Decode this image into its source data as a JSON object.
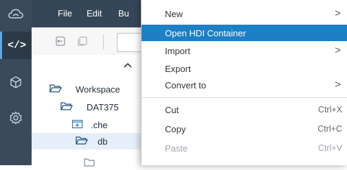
{
  "menubar": {
    "items": [
      "File",
      "Edit",
      "Bu"
    ]
  },
  "rail": {
    "code_label": "</>"
  },
  "tree": {
    "rows": [
      {
        "label": "Workspace",
        "icon": "folder-open-icon"
      },
      {
        "label": "DAT375",
        "icon": "folder-open-icon"
      },
      {
        "label": ".che",
        "icon": "folder-plus-icon"
      },
      {
        "label": "db",
        "icon": "folder-open-icon",
        "selected": true
      }
    ]
  },
  "context_menu": {
    "items": [
      {
        "label": "New",
        "submenu": true,
        "arrow": ">"
      },
      {
        "label": "Open HDI Container",
        "highlighted": true
      },
      {
        "label": "Import",
        "submenu": true,
        "arrow": ">"
      },
      {
        "label": "Export"
      },
      {
        "label": "Convert to",
        "submenu": true,
        "arrow": ">"
      },
      {
        "label": "Cut",
        "shortcut": "Ctrl+X"
      },
      {
        "label": "Copy",
        "shortcut": "Ctrl+C"
      },
      {
        "label": "Paste",
        "shortcut": "Ctrl+V",
        "disabled": true
      }
    ]
  },
  "colors": {
    "menubar_bg": "#354656",
    "rail_bg": "#3b4a5a",
    "highlight": "#1d7fc4",
    "selected_row": "#e5eff9"
  }
}
